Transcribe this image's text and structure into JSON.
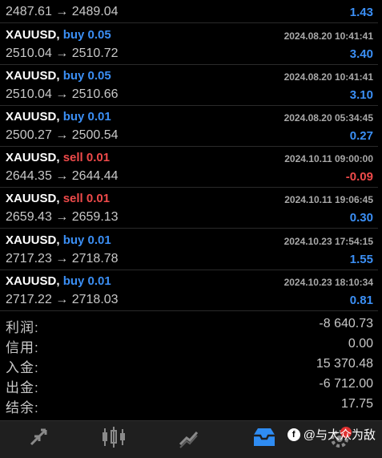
{
  "trades": [
    {
      "symbol": "",
      "side": "",
      "side_class": "",
      "lot": "",
      "time": "",
      "price": "2487.61 → 2489.04",
      "profit": "1.43",
      "profit_class": "pos"
    },
    {
      "symbol": "XAUUSD,",
      "side": "buy",
      "side_class": "buy",
      "lot": "0.05",
      "time": "2024.08.20 10:41:41",
      "price": "2510.04 → 2510.72",
      "profit": "3.40",
      "profit_class": "pos"
    },
    {
      "symbol": "XAUUSD,",
      "side": "buy",
      "side_class": "buy",
      "lot": "0.05",
      "time": "2024.08.20 10:41:41",
      "price": "2510.04 → 2510.66",
      "profit": "3.10",
      "profit_class": "pos"
    },
    {
      "symbol": "XAUUSD,",
      "side": "buy",
      "side_class": "buy",
      "lot": "0.01",
      "time": "2024.08.20 05:34:45",
      "price": "2500.27 → 2500.54",
      "profit": "0.27",
      "profit_class": "pos"
    },
    {
      "symbol": "XAUUSD,",
      "side": "sell",
      "side_class": "sell",
      "lot": "0.01",
      "time": "2024.10.11 09:00:00",
      "price": "2644.35 → 2644.44",
      "profit": "-0.09",
      "profit_class": "neg"
    },
    {
      "symbol": "XAUUSD,",
      "side": "sell",
      "side_class": "sell",
      "lot": "0.01",
      "time": "2024.10.11 19:06:45",
      "price": "2659.43 → 2659.13",
      "profit": "0.30",
      "profit_class": "pos"
    },
    {
      "symbol": "XAUUSD,",
      "side": "buy",
      "side_class": "buy",
      "lot": "0.01",
      "time": "2024.10.23 17:54:15",
      "price": "2717.23 → 2718.78",
      "profit": "1.55",
      "profit_class": "pos"
    },
    {
      "symbol": "XAUUSD,",
      "side": "buy",
      "side_class": "buy",
      "lot": "0.01",
      "time": "2024.10.23 18:10:34",
      "price": "2717.22 → 2718.03",
      "profit": "0.81",
      "profit_class": "pos"
    }
  ],
  "summary": [
    {
      "label": "利润:",
      "value": "-8 640.73"
    },
    {
      "label": "信用:",
      "value": "0.00"
    },
    {
      "label": "入金:",
      "value": "15 370.48"
    },
    {
      "label": "出金:",
      "value": "-6 712.00"
    },
    {
      "label": "结余:",
      "value": "17.75"
    }
  ],
  "nav": {
    "tabs": [
      {
        "name": "tab-quotes",
        "icon": "arrows-icon"
      },
      {
        "name": "tab-chart",
        "icon": "candlestick-icon"
      },
      {
        "name": "tab-trade",
        "icon": "trend-icon"
      },
      {
        "name": "tab-history",
        "icon": "inbox-icon"
      },
      {
        "name": "tab-settings",
        "icon": "gear-icon"
      }
    ],
    "active_color": "#2f8cf2",
    "inactive_color": "#8a8a8a"
  },
  "watermark": {
    "logo": "f",
    "text": "@与大众为敌"
  }
}
